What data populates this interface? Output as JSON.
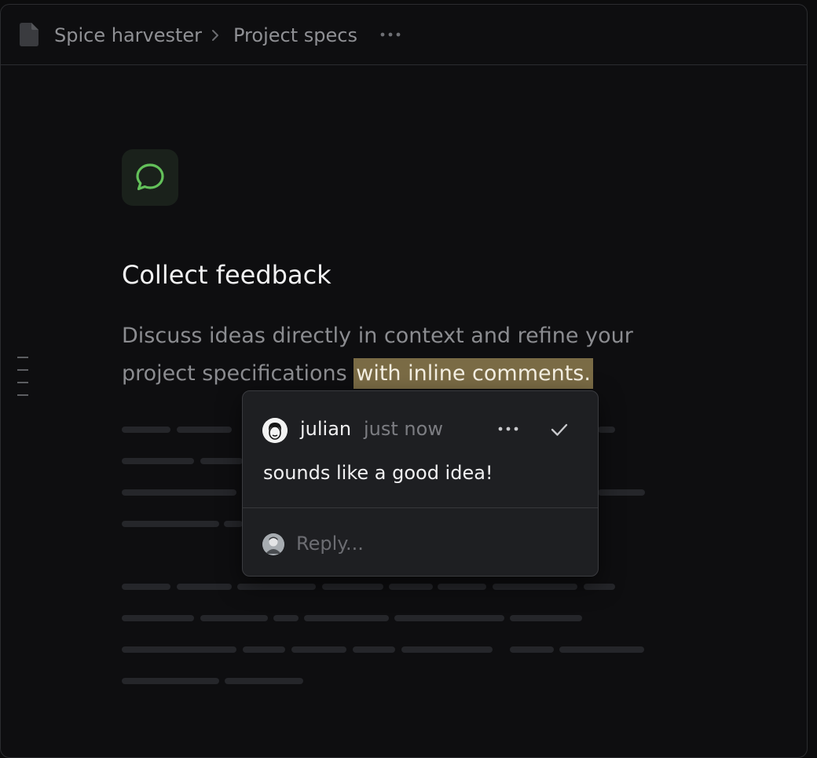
{
  "breadcrumb": {
    "items": [
      "Spice harvester",
      "Project specs"
    ],
    "icon": "document-icon",
    "more_icon": "more-horizontal-icon"
  },
  "feature": {
    "icon": "chat-bubble-icon",
    "icon_color": "#63c15a",
    "title": "Collect feedback",
    "description_plain": "Discuss ideas directly in context and refine your project specifications",
    "description_highlight": "with inline comments."
  },
  "comment": {
    "author": "julian",
    "time": "just now",
    "body": "sounds like a good idea!",
    "more_icon": "more-horizontal-icon",
    "resolve_icon": "check-icon",
    "reply_placeholder": "Reply..."
  },
  "colors": {
    "background": "#0e0e10",
    "highlight": "#7a6b45",
    "popover": "#1e1f22",
    "accent_green": "#63c15a"
  }
}
